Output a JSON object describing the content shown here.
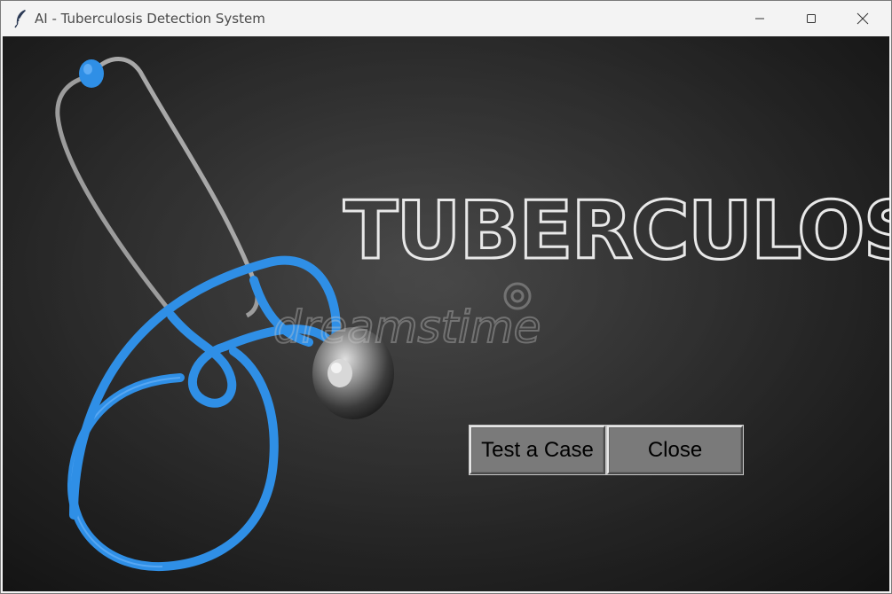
{
  "window": {
    "title": "AI - Tuberculosis Detection System",
    "icon": "feather-icon",
    "controls": [
      "minimize-icon",
      "maximize-icon",
      "close-icon"
    ]
  },
  "background": {
    "heading": "TUBERCULOSIS",
    "watermark": "dreamstime",
    "image": "stethoscope-on-chalkboard",
    "colors": {
      "chalkboard": "#3a3a3a",
      "stethoscope": "#2f8fe6",
      "chalk": "#e8e8e8"
    }
  },
  "buttons": {
    "test_label": "Test a Case",
    "close_label": "Close",
    "color": "#7a7a7a"
  }
}
